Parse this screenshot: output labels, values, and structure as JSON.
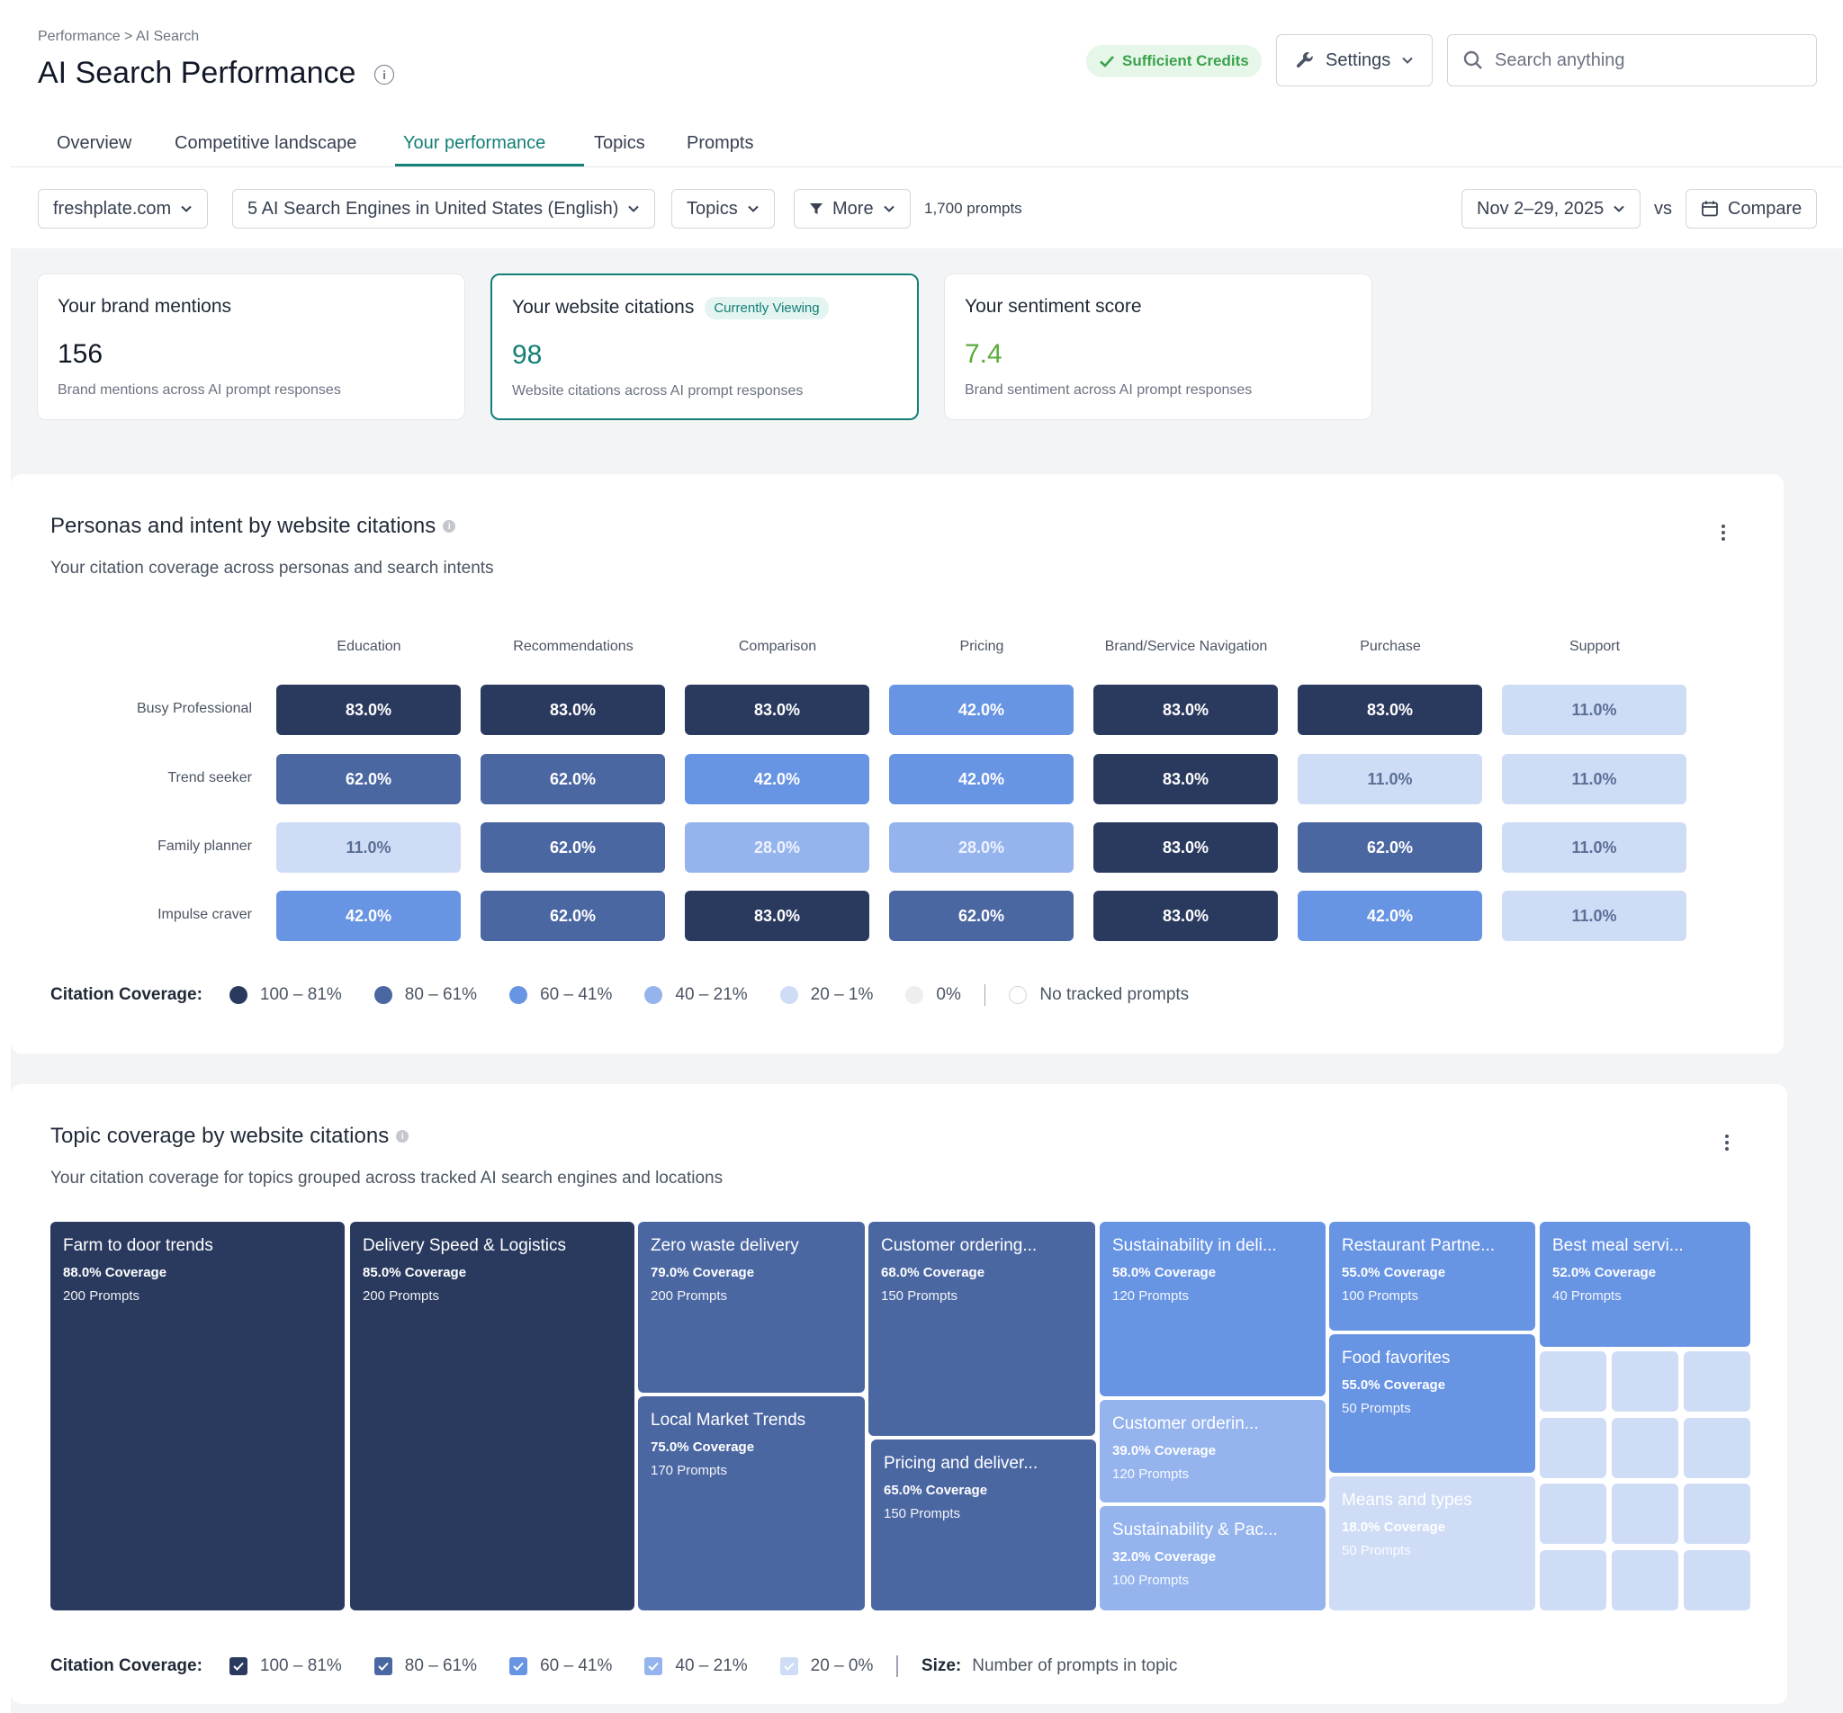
{
  "breadcrumb": "Performance > AI Search",
  "page_title": "AI Search Performance",
  "credits_label": "Sufficient Credits",
  "settings_label": "Settings",
  "search_placeholder": "Search anything",
  "tabs": [
    "Overview",
    "Competitive landscape",
    "Your performance",
    "Topics",
    "Prompts"
  ],
  "active_tab": "Your performance",
  "filters": {
    "domain": "freshplate.com",
    "engines": "5 AI Search Engines in United States (English)",
    "topics": "Topics",
    "more": "More",
    "prompts_count": "1,700 prompts",
    "date_range": "Nov 2–29, 2025",
    "vs": "vs",
    "compare": "Compare"
  },
  "kpis": [
    {
      "title": "Your brand mentions",
      "value": "156",
      "sub": "Brand mentions across AI prompt responses",
      "badge": ""
    },
    {
      "title": "Your website citations",
      "value": "98",
      "sub": "Website citations across AI prompt responses",
      "badge": "Currently Viewing"
    },
    {
      "title": "Your sentiment score",
      "value": "7.4",
      "sub": "Brand sentiment across AI prompt responses",
      "badge": ""
    }
  ],
  "personas": {
    "title": "Personas and intent by website citations",
    "subtitle": "Your citation coverage across personas and search intents",
    "columns": [
      "Education",
      "Recommendations",
      "Comparison",
      "Pricing",
      "Brand/Service Navigation",
      "Purchase",
      "Support"
    ],
    "rows": [
      {
        "name": "Busy Professional",
        "values": [
          83.0,
          83.0,
          83.0,
          42.0,
          83.0,
          83.0,
          11.0
        ]
      },
      {
        "name": "Trend seeker",
        "values": [
          62.0,
          62.0,
          42.0,
          42.0,
          83.0,
          11.0,
          11.0
        ]
      },
      {
        "name": "Family planner",
        "values": [
          11.0,
          62.0,
          28.0,
          28.0,
          83.0,
          62.0,
          11.0
        ]
      },
      {
        "name": "Impulse craver",
        "values": [
          42.0,
          62.0,
          83.0,
          62.0,
          83.0,
          42.0,
          11.0
        ]
      }
    ],
    "legend_label": "Citation Coverage:",
    "legend": [
      "100 – 81%",
      "80 – 61%",
      "60 – 41%",
      "40 – 21%",
      "20 – 1%",
      "0%",
      "No tracked prompts"
    ]
  },
  "topics": {
    "title": "Topic coverage by website citations",
    "subtitle": "Your citation coverage for topics grouped across tracked AI search engines and locations",
    "tiles": [
      {
        "name": "Farm to door trends",
        "coverage": "88.0% Coverage",
        "prompts": "200 Prompts",
        "value": 88.0
      },
      {
        "name": "Delivery Speed & Logistics",
        "coverage": "85.0% Coverage",
        "prompts": "200 Prompts",
        "value": 85.0
      },
      {
        "name": "Zero waste delivery",
        "coverage": "79.0% Coverage",
        "prompts": "200 Prompts",
        "value": 79.0
      },
      {
        "name": "Local Market Trends",
        "coverage": "75.0% Coverage",
        "prompts": "170 Prompts",
        "value": 75.0
      },
      {
        "name": "Customer ordering...",
        "coverage": "68.0% Coverage",
        "prompts": "150 Prompts",
        "value": 68.0
      },
      {
        "name": "Pricing and deliver...",
        "coverage": "65.0% Coverage",
        "prompts": "150 Prompts",
        "value": 65.0
      },
      {
        "name": "Sustainability in deli...",
        "coverage": "58.0% Coverage",
        "prompts": "120 Prompts",
        "value": 58.0
      },
      {
        "name": "Customer orderin...",
        "coverage": "39.0% Coverage",
        "prompts": "120 Prompts",
        "value": 39.0
      },
      {
        "name": "Sustainability & Pac...",
        "coverage": "32.0% Coverage",
        "prompts": "100 Prompts",
        "value": 32.0
      },
      {
        "name": "Restaurant Partne...",
        "coverage": "55.0% Coverage",
        "prompts": "100 Prompts",
        "value": 55.0
      },
      {
        "name": "Food favorites",
        "coverage": "55.0% Coverage",
        "prompts": "50 Prompts",
        "value": 55.0
      },
      {
        "name": "Means and types",
        "coverage": "18.0% Coverage",
        "prompts": "50 Prompts",
        "value": 18.0
      },
      {
        "name": "Best meal servi...",
        "coverage": "52.0% Coverage",
        "prompts": "40 Prompts",
        "value": 52.0
      }
    ],
    "legend_label": "Citation Coverage:",
    "legend": [
      "100 – 81%",
      "80 – 61%",
      "60 – 41%",
      "40 – 21%",
      "20 – 0%"
    ],
    "size_label": "Size:",
    "size_text": "Number of prompts in topic"
  },
  "colors": {
    "accent": "#137f75",
    "level1": "#2a3a5f",
    "level2": "#4b67a2",
    "level3": "#6894e4",
    "level4": "#95b4ee",
    "level5": "#cfdcf6",
    "level6": "#eeeeee",
    "sentiment": "#5bab3c"
  }
}
